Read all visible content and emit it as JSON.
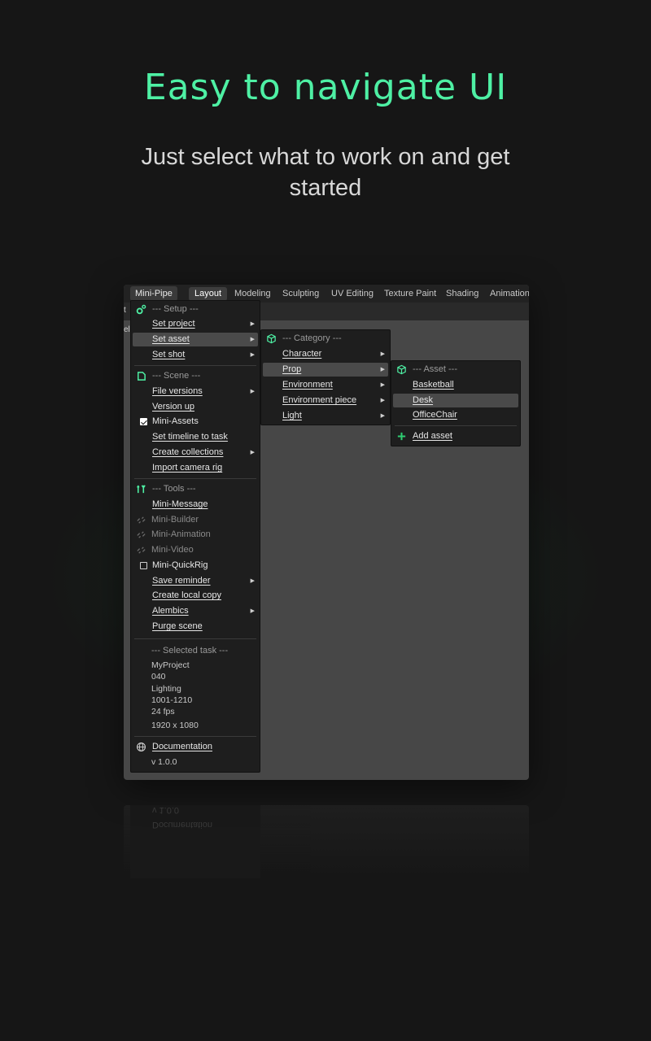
{
  "hero": {
    "title": "Easy to navigate UI",
    "subtitle": "Just select what to work on and get started"
  },
  "window": {
    "app_menu": "Mini-Pipe",
    "tabs": [
      "Layout",
      "Modeling",
      "Sculpting",
      "UV Editing",
      "Texture Paint",
      "Shading",
      "Animation"
    ],
    "active_tab": "Layout",
    "edge_glyphs": [
      "t",
      "el"
    ]
  },
  "main_menu": {
    "setup_header": "--- Setup ---",
    "set_project": "Set project",
    "set_asset": "Set asset",
    "set_shot": "Set shot",
    "scene_header": "--- Scene ---",
    "file_versions": "File versions",
    "version_up": "Version up",
    "mini_assets": "Mini-Assets",
    "mini_assets_checked": true,
    "set_timeline": "Set timeline to task",
    "create_collections": "Create collections",
    "import_camera_rig": "Import camera rig",
    "tools_header": "--- Tools ---",
    "mini_message": "Mini-Message",
    "mini_builder": "Mini-Builder",
    "mini_animation": "Mini-Animation",
    "mini_video": "Mini-Video",
    "mini_quickrig": "Mini-QuickRig",
    "mini_quickrig_checked": false,
    "save_reminder": "Save reminder",
    "create_local_copy": "Create local copy",
    "alembics": "Alembics",
    "purge_scene": "Purge scene",
    "selected_task_header": "--- Selected task ---",
    "task_info": [
      "MyProject",
      "040",
      "Lighting",
      "1001-1210",
      "24 fps",
      "1920 x 1080"
    ],
    "documentation": "Documentation",
    "version": "v 1.0.0"
  },
  "category_menu": {
    "header": "--- Category ---",
    "items": [
      "Character",
      "Prop",
      "Environment",
      "Environment piece",
      "Light"
    ],
    "highlighted": "Prop"
  },
  "asset_menu": {
    "header": "--- Asset ---",
    "items": [
      "Basketball",
      "Desk",
      "OfficeChair"
    ],
    "highlighted": "Desk",
    "add_asset": "Add asset"
  },
  "reflection": {
    "documentation": "Documentation",
    "version": "v 1.0.0"
  },
  "colors": {
    "accent": "#4ef0a4",
    "background": "#161616",
    "menu_bg": "#1e1e1e",
    "highlight": "#4a4a4a"
  }
}
